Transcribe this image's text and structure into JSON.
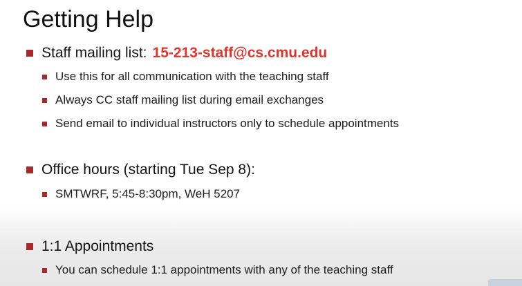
{
  "title": "Getting Help",
  "sections": [
    {
      "label": "Staff mailing list:",
      "email": "15-213-staff@cs.cmu.edu",
      "subitems": [
        "Use this for all communication with the teaching staff",
        "Always CC staff mailing list during email exchanges",
        "Send email to individual instructors only to schedule appointments"
      ]
    },
    {
      "label": "Office hours (starting Tue Sep 8):",
      "subitems": [
        "SMTWRF, 5:45-8:30pm, WeH 5207"
      ]
    },
    {
      "label": "1:1 Appointments",
      "subitems": [
        "You can schedule 1:1 appointments with any of the teaching staff"
      ]
    }
  ],
  "colors": {
    "bullet": "#a52a2a",
    "email": "#e0342f"
  }
}
